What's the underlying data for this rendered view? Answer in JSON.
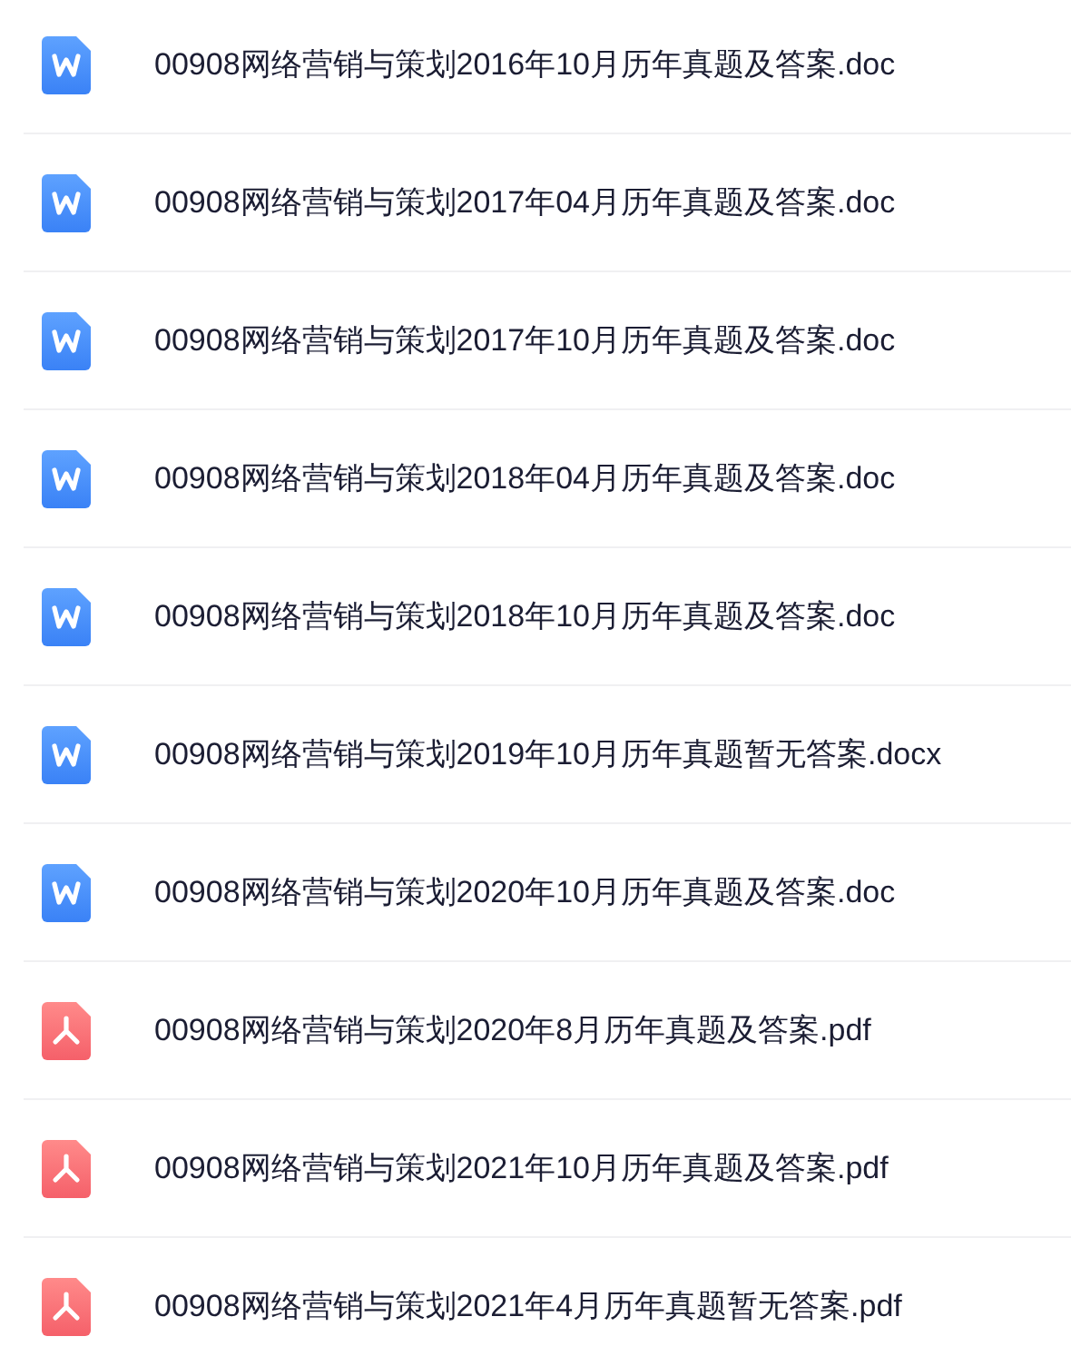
{
  "files": [
    {
      "name": "00908网络营销与策划2016年10月历年真题及答案.doc",
      "kind": "word"
    },
    {
      "name": "00908网络营销与策划2017年04月历年真题及答案.doc",
      "kind": "word"
    },
    {
      "name": "00908网络营销与策划2017年10月历年真题及答案.doc",
      "kind": "word"
    },
    {
      "name": "00908网络营销与策划2018年04月历年真题及答案.doc",
      "kind": "word"
    },
    {
      "name": "00908网络营销与策划2018年10月历年真题及答案.doc",
      "kind": "word"
    },
    {
      "name": "00908网络营销与策划2019年10月历年真题暂无答案.docx",
      "kind": "word"
    },
    {
      "name": "00908网络营销与策划2020年10月历年真题及答案.doc",
      "kind": "word"
    },
    {
      "name": "00908网络营销与策划2020年8月历年真题及答案.pdf",
      "kind": "pdf"
    },
    {
      "name": "00908网络营销与策划2021年10月历年真题及答案.pdf",
      "kind": "pdf"
    },
    {
      "name": "00908网络营销与策划2021年4月历年真题暂无答案.pdf",
      "kind": "pdf"
    }
  ]
}
